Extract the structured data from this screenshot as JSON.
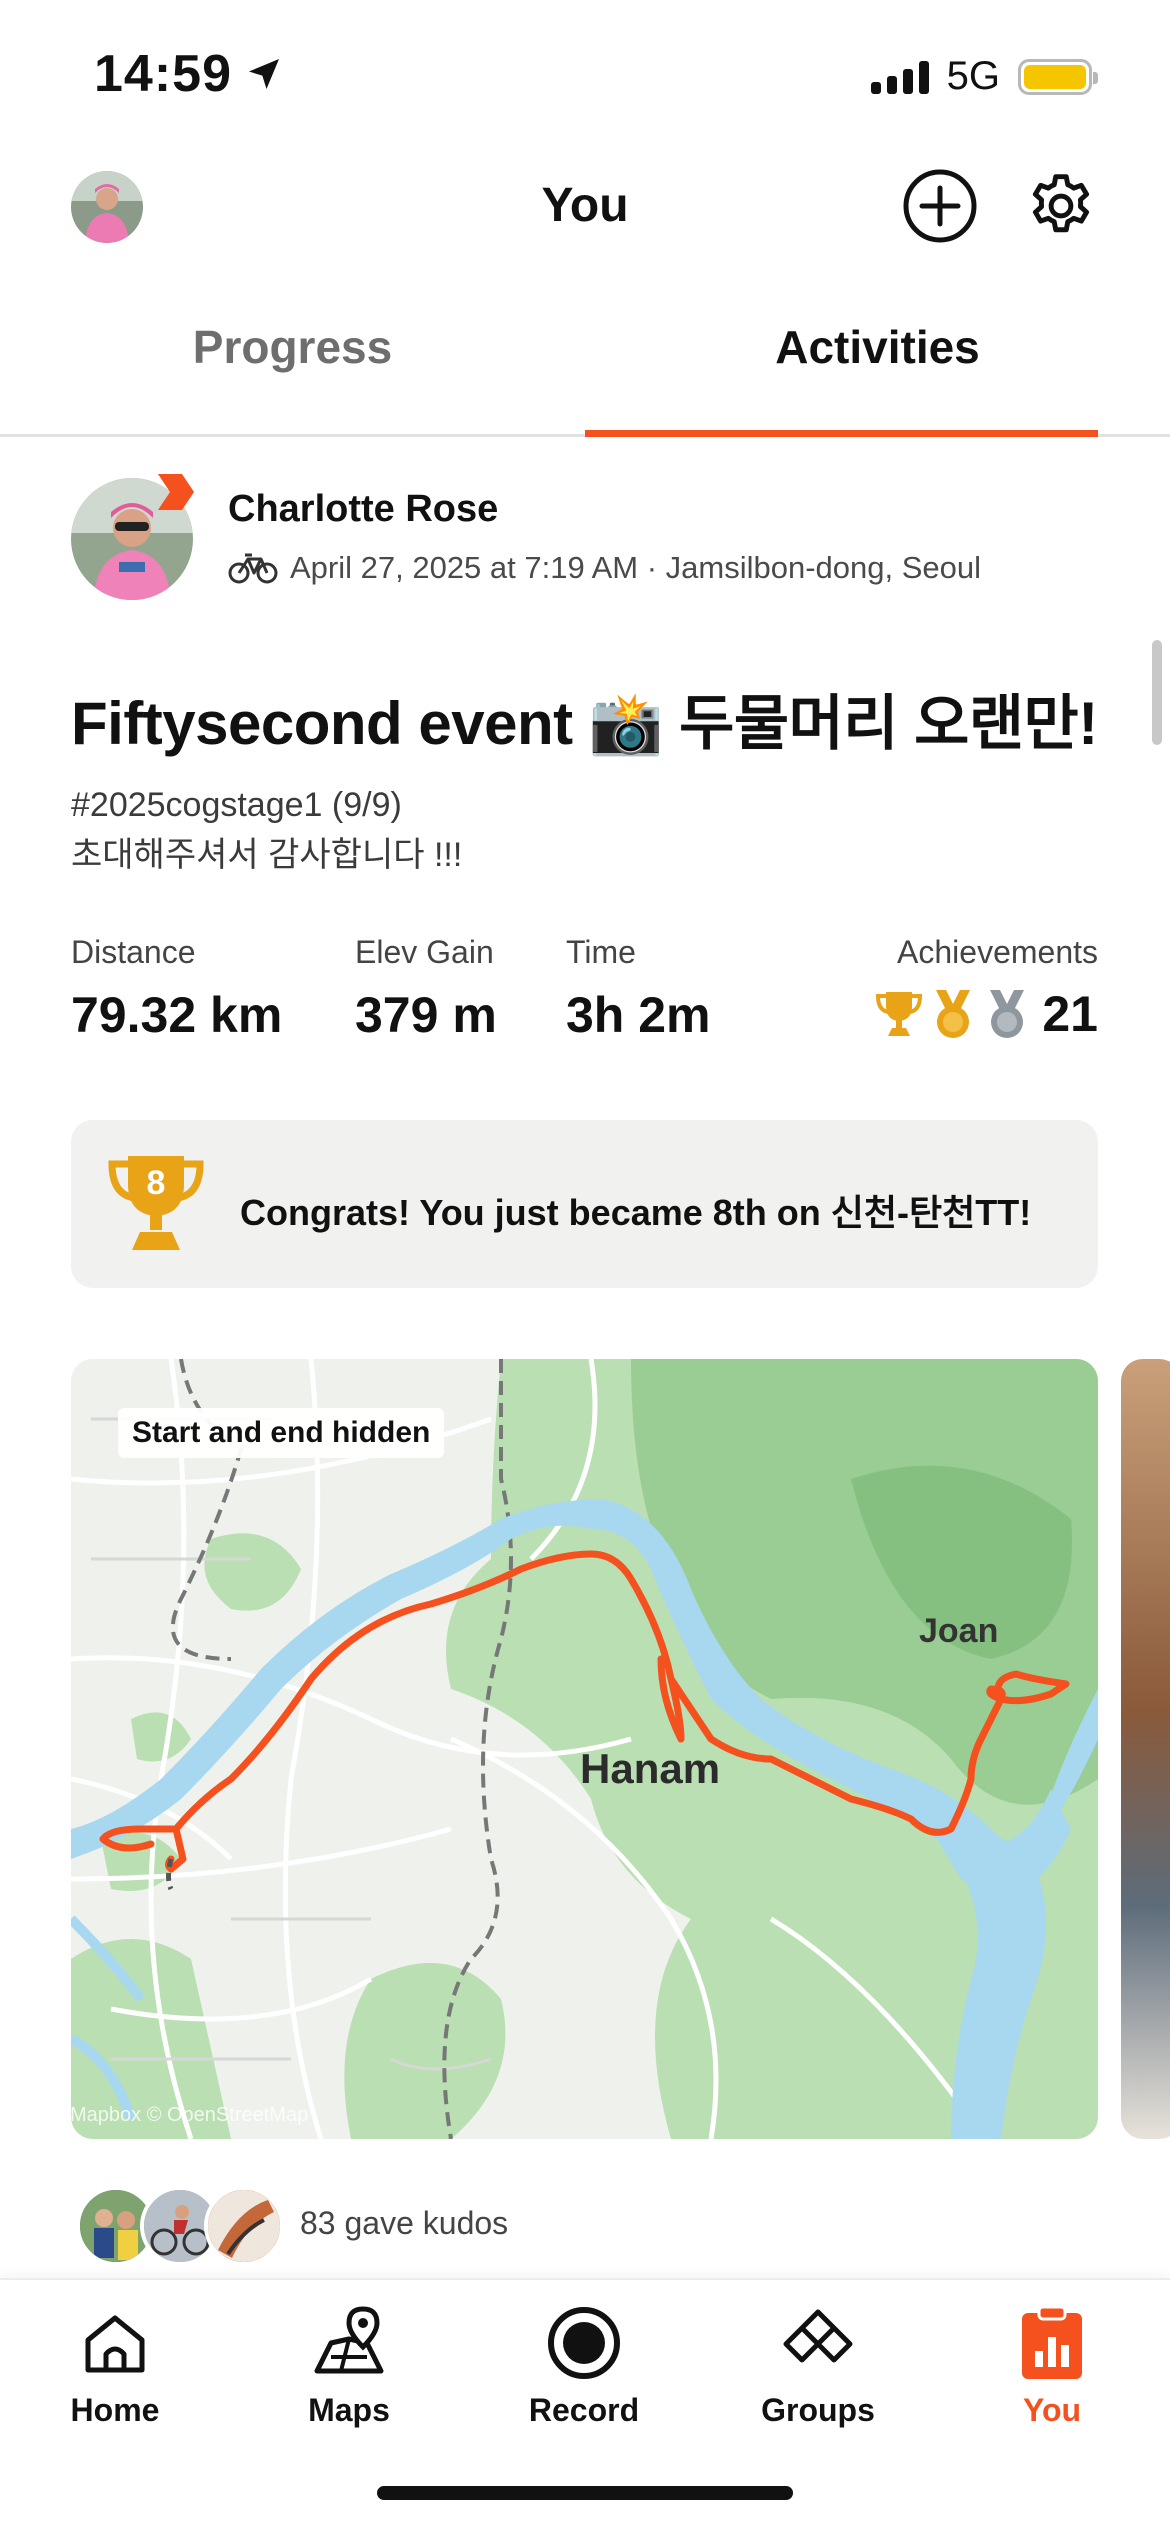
{
  "status_bar": {
    "time": "14:59",
    "network": "5G"
  },
  "header": {
    "title": "You"
  },
  "tabs": [
    {
      "label": "Progress",
      "active": false
    },
    {
      "label": "Activities",
      "active": true
    }
  ],
  "activity": {
    "athlete_name": "Charlotte Rose",
    "sport_icon": "bike-icon",
    "meta": "April 27, 2025 at 7:19 AM · Jamsilbon-dong, Seoul",
    "title": "Fiftysecond event 📸 두물머리 오랜만!",
    "description_line1": "#2025cogstage1 (9/9)",
    "description_line2": "초대해주셔서 감사합니다 !!!",
    "stats": [
      {
        "label": "Distance",
        "value": "79.32 km"
      },
      {
        "label": "Elev Gain",
        "value": "379 m"
      },
      {
        "label": "Time",
        "value": "3h 2m"
      }
    ],
    "achievements": {
      "label": "Achievements",
      "count": "21"
    },
    "congrats": {
      "rank": "8",
      "text": "Congrats! You just became 8th on 신천-탄천TT!"
    },
    "map": {
      "chip": "Start and end hidden",
      "city": "Hanam",
      "town": "Joan",
      "attribution": "Mapbox © OpenStreetMap"
    },
    "kudos_text": "83 gave kudos"
  },
  "nav": [
    {
      "label": "Home",
      "icon": "home-icon",
      "active": false
    },
    {
      "label": "Maps",
      "icon": "maps-icon",
      "active": false
    },
    {
      "label": "Record",
      "icon": "record-icon",
      "active": false
    },
    {
      "label": "Groups",
      "icon": "groups-icon",
      "active": false
    },
    {
      "label": "You",
      "icon": "you-icon",
      "active": true
    }
  ],
  "colors": {
    "accent": "#f4511e",
    "gold": "#e8a317",
    "text": "#111111",
    "muted": "#6e6e6e",
    "card_bg": "#f1f1ef",
    "map_water": "#a8d8f0",
    "map_green": "#b8dfb0"
  }
}
